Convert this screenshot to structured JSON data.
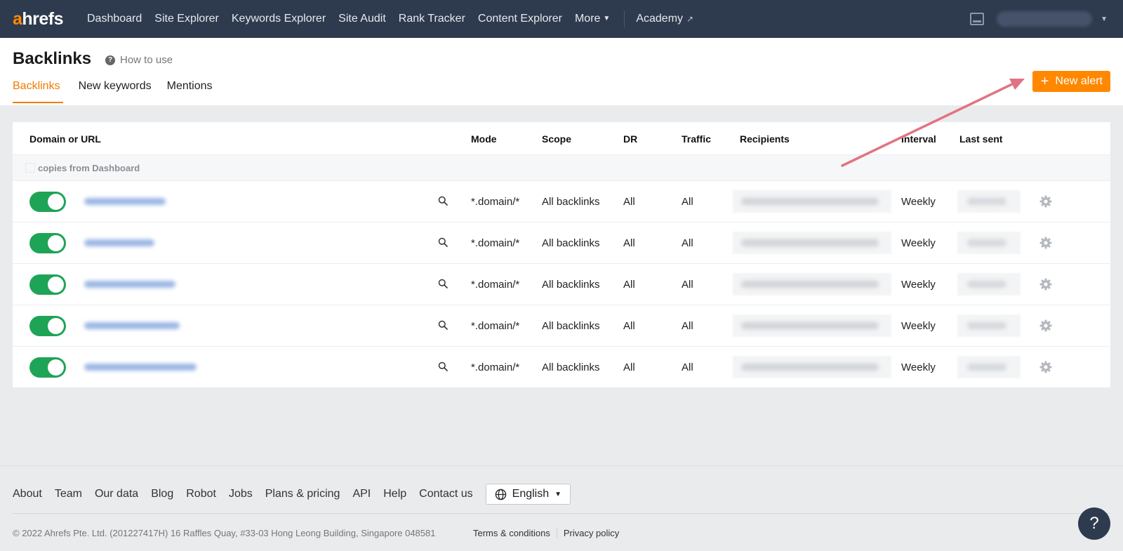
{
  "brand": {
    "logo_a": "a",
    "logo_rest": "hrefs",
    "accent": "#ff8800",
    "nav_bg": "#2e3a4d",
    "toggle_on": "#1ea456"
  },
  "nav": {
    "items": [
      "Dashboard",
      "Site Explorer",
      "Keywords Explorer",
      "Site Audit",
      "Rank Tracker",
      "Content Explorer"
    ],
    "more": "More",
    "academy": "Academy"
  },
  "header": {
    "title": "Backlinks",
    "how_to_use": "How to use",
    "tabs": [
      "Backlinks",
      "New keywords",
      "Mentions"
    ],
    "active_tab": "Backlinks",
    "new_alert_plus": "+",
    "new_alert_label": "New alert"
  },
  "table": {
    "columns": {
      "domain": "Domain or URL",
      "mode": "Mode",
      "scope": "Scope",
      "dr": "DR",
      "traffic": "Traffic",
      "recipients": "Recipients",
      "interval": "Interval",
      "last_sent": "Last sent"
    },
    "group_label": "copies from Dashboard",
    "rows": [
      {
        "enabled": true,
        "mode": "*.domain/*",
        "scope": "All backlinks",
        "dr": "All",
        "traffic": "All",
        "interval": "Weekly"
      },
      {
        "enabled": true,
        "mode": "*.domain/*",
        "scope": "All backlinks",
        "dr": "All",
        "traffic": "All",
        "interval": "Weekly"
      },
      {
        "enabled": true,
        "mode": "*.domain/*",
        "scope": "All backlinks",
        "dr": "All",
        "traffic": "All",
        "interval": "Weekly"
      },
      {
        "enabled": true,
        "mode": "*.domain/*",
        "scope": "All backlinks",
        "dr": "All",
        "traffic": "All",
        "interval": "Weekly"
      },
      {
        "enabled": true,
        "mode": "*.domain/*",
        "scope": "All backlinks",
        "dr": "All",
        "traffic": "All",
        "interval": "Weekly"
      }
    ]
  },
  "footer": {
    "links": [
      "About",
      "Team",
      "Our data",
      "Blog",
      "Robot",
      "Jobs",
      "Plans & pricing",
      "API",
      "Help",
      "Contact us"
    ],
    "language": "English",
    "copyright": "© 2022 Ahrefs Pte. Ltd. (201227417H) 16 Raffles Quay, #33-03 Hong Leong Building, Singapore 048581",
    "terms": "Terms & conditions",
    "privacy": "Privacy policy",
    "help_bubble": "?"
  }
}
